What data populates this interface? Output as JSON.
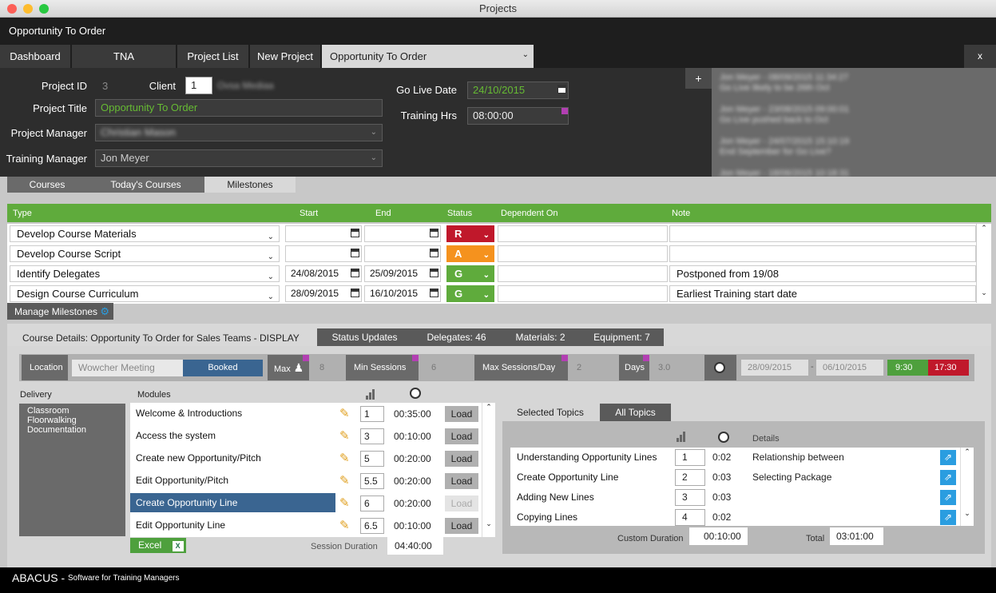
{
  "window": {
    "title": "Projects"
  },
  "header": {
    "title": "Opportunity To Order"
  },
  "nav": {
    "tabs": [
      "Dashboard",
      "TNA",
      "Project List",
      "New Project"
    ],
    "active_tab": "Opportunity To Order",
    "close_label": "x"
  },
  "project": {
    "id_label": "Project ID",
    "id_value": "3",
    "client_label": "Client",
    "client_number": "1",
    "client_name": "Ovsa Mediaa",
    "title_label": "Project Title",
    "title_value": "Opportunity To Order",
    "manager_label": "Project Manager",
    "manager_value": "Christian Mason",
    "training_manager_label": "Training Manager",
    "training_manager_value": "Jon Meyer",
    "golive_label": "Go Live Date",
    "golive_value": "24/10/2015",
    "training_hrs_label": "Training Hrs",
    "training_hrs_value": "08:00:00"
  },
  "notes": {
    "add_label": "+",
    "items": [
      {
        "head": "Jon Meyer - 08/09/2015 11:34:27",
        "body": "Go Live likely to be 26th Oct"
      },
      {
        "head": "Jon Meyer - 23/08/2015 09:00:01",
        "body": "Go Live pushed back to Oct"
      },
      {
        "head": "Jon Meyer - 24/07/2015 15:10:19",
        "body": "End September for Go Live?"
      },
      {
        "head": "Jon Meyer - 18/06/2015 10:18:31",
        "body": ""
      }
    ]
  },
  "subtabs": [
    "Courses",
    "Today's Courses",
    "Milestones"
  ],
  "milestones": {
    "headers": [
      "Type",
      "Start",
      "End",
      "Status",
      "Dependent On",
      "Note"
    ],
    "rows": [
      {
        "type": "Develop Course Materials",
        "start": "",
        "end": "",
        "status": "R",
        "dependent": "",
        "note": ""
      },
      {
        "type": "Develop Course Script",
        "start": "",
        "end": "",
        "status": "A",
        "dependent": "",
        "note": ""
      },
      {
        "type": "Identify Delegates",
        "start": "24/08/2015",
        "end": "25/09/2015",
        "status": "G",
        "dependent": "",
        "note": "Postponed from 19/08"
      },
      {
        "type": "Design Course Curriculum",
        "start": "28/09/2015",
        "end": "16/10/2015",
        "status": "G",
        "dependent": "",
        "note": "Earliest Training start date"
      }
    ],
    "manage_label": "Manage Milestones"
  },
  "course_details": {
    "title": "Course Details: Opportunity To Order for Sales Teams - DISPLAY",
    "tabs": [
      "Status Updates",
      "Delegates: 46",
      "Materials: 2",
      "Equipment: 7"
    ],
    "location_label": "Location",
    "location_value": "Wowcher Meeting",
    "booked_label": "Booked",
    "max_label": "Max",
    "max_value": "8",
    "min_sessions_label": "Min Sessions",
    "min_sessions_value": "6",
    "max_sessions_label": "Max Sessions/Day",
    "max_sessions_value": "2",
    "days_label": "Days",
    "days_value": "3.0",
    "start_date": "28/09/2015",
    "dash": "-",
    "end_date": "06/10/2015",
    "start_time": "9:30",
    "end_time": "17:30"
  },
  "delivery": {
    "label": "Delivery",
    "items": [
      "Classroom",
      "Floorwalking",
      "Documentation"
    ]
  },
  "modules": {
    "label": "Modules",
    "load_label": "Load",
    "rows": [
      {
        "name": "Welcome & Introductions",
        "num": "1",
        "dur": "00:35:00"
      },
      {
        "name": "Access the system",
        "num": "3",
        "dur": "00:10:00"
      },
      {
        "name": "Create new Opportunity/Pitch",
        "num": "5",
        "dur": "00:20:00"
      },
      {
        "name": "Edit Opportunity/Pitch",
        "num": "5.5",
        "dur": "00:20:00"
      },
      {
        "name": "Create Opportunity Line",
        "num": "6",
        "dur": "00:20:00"
      },
      {
        "name": "Edit Opportunity Line",
        "num": "6.5",
        "dur": "00:10:00"
      }
    ],
    "excel_label": "Excel",
    "session_duration_label": "Session Duration",
    "session_duration_value": "04:40:00"
  },
  "topics": {
    "tabs": [
      "Selected Topics",
      "All Topics"
    ],
    "details_label": "Details",
    "rows": [
      {
        "name": "Understanding Opportunity Lines",
        "num": "1",
        "dur": "0:02",
        "detail": "Relationship between"
      },
      {
        "name": "Create Opportunity Line",
        "num": "2",
        "dur": "0:03",
        "detail": "Selecting Package"
      },
      {
        "name": "Adding New Lines",
        "num": "3",
        "dur": "0:03",
        "detail": ""
      },
      {
        "name": "Copying Lines",
        "num": "4",
        "dur": "0:02",
        "detail": ""
      }
    ],
    "custom_duration_label": "Custom Duration",
    "custom_duration_value": "00:10:00",
    "total_label": "Total",
    "total_value": "03:01:00"
  },
  "footer": {
    "brand": "ABACUS - ",
    "tagline": "Software for Training Managers"
  },
  "colors": {
    "green": "#5fab3c",
    "red": "#c0182b",
    "amber": "#f5921e",
    "selected": "#3a6591",
    "blue_btn": "#2a9de0",
    "pink": "#b33fb3"
  }
}
